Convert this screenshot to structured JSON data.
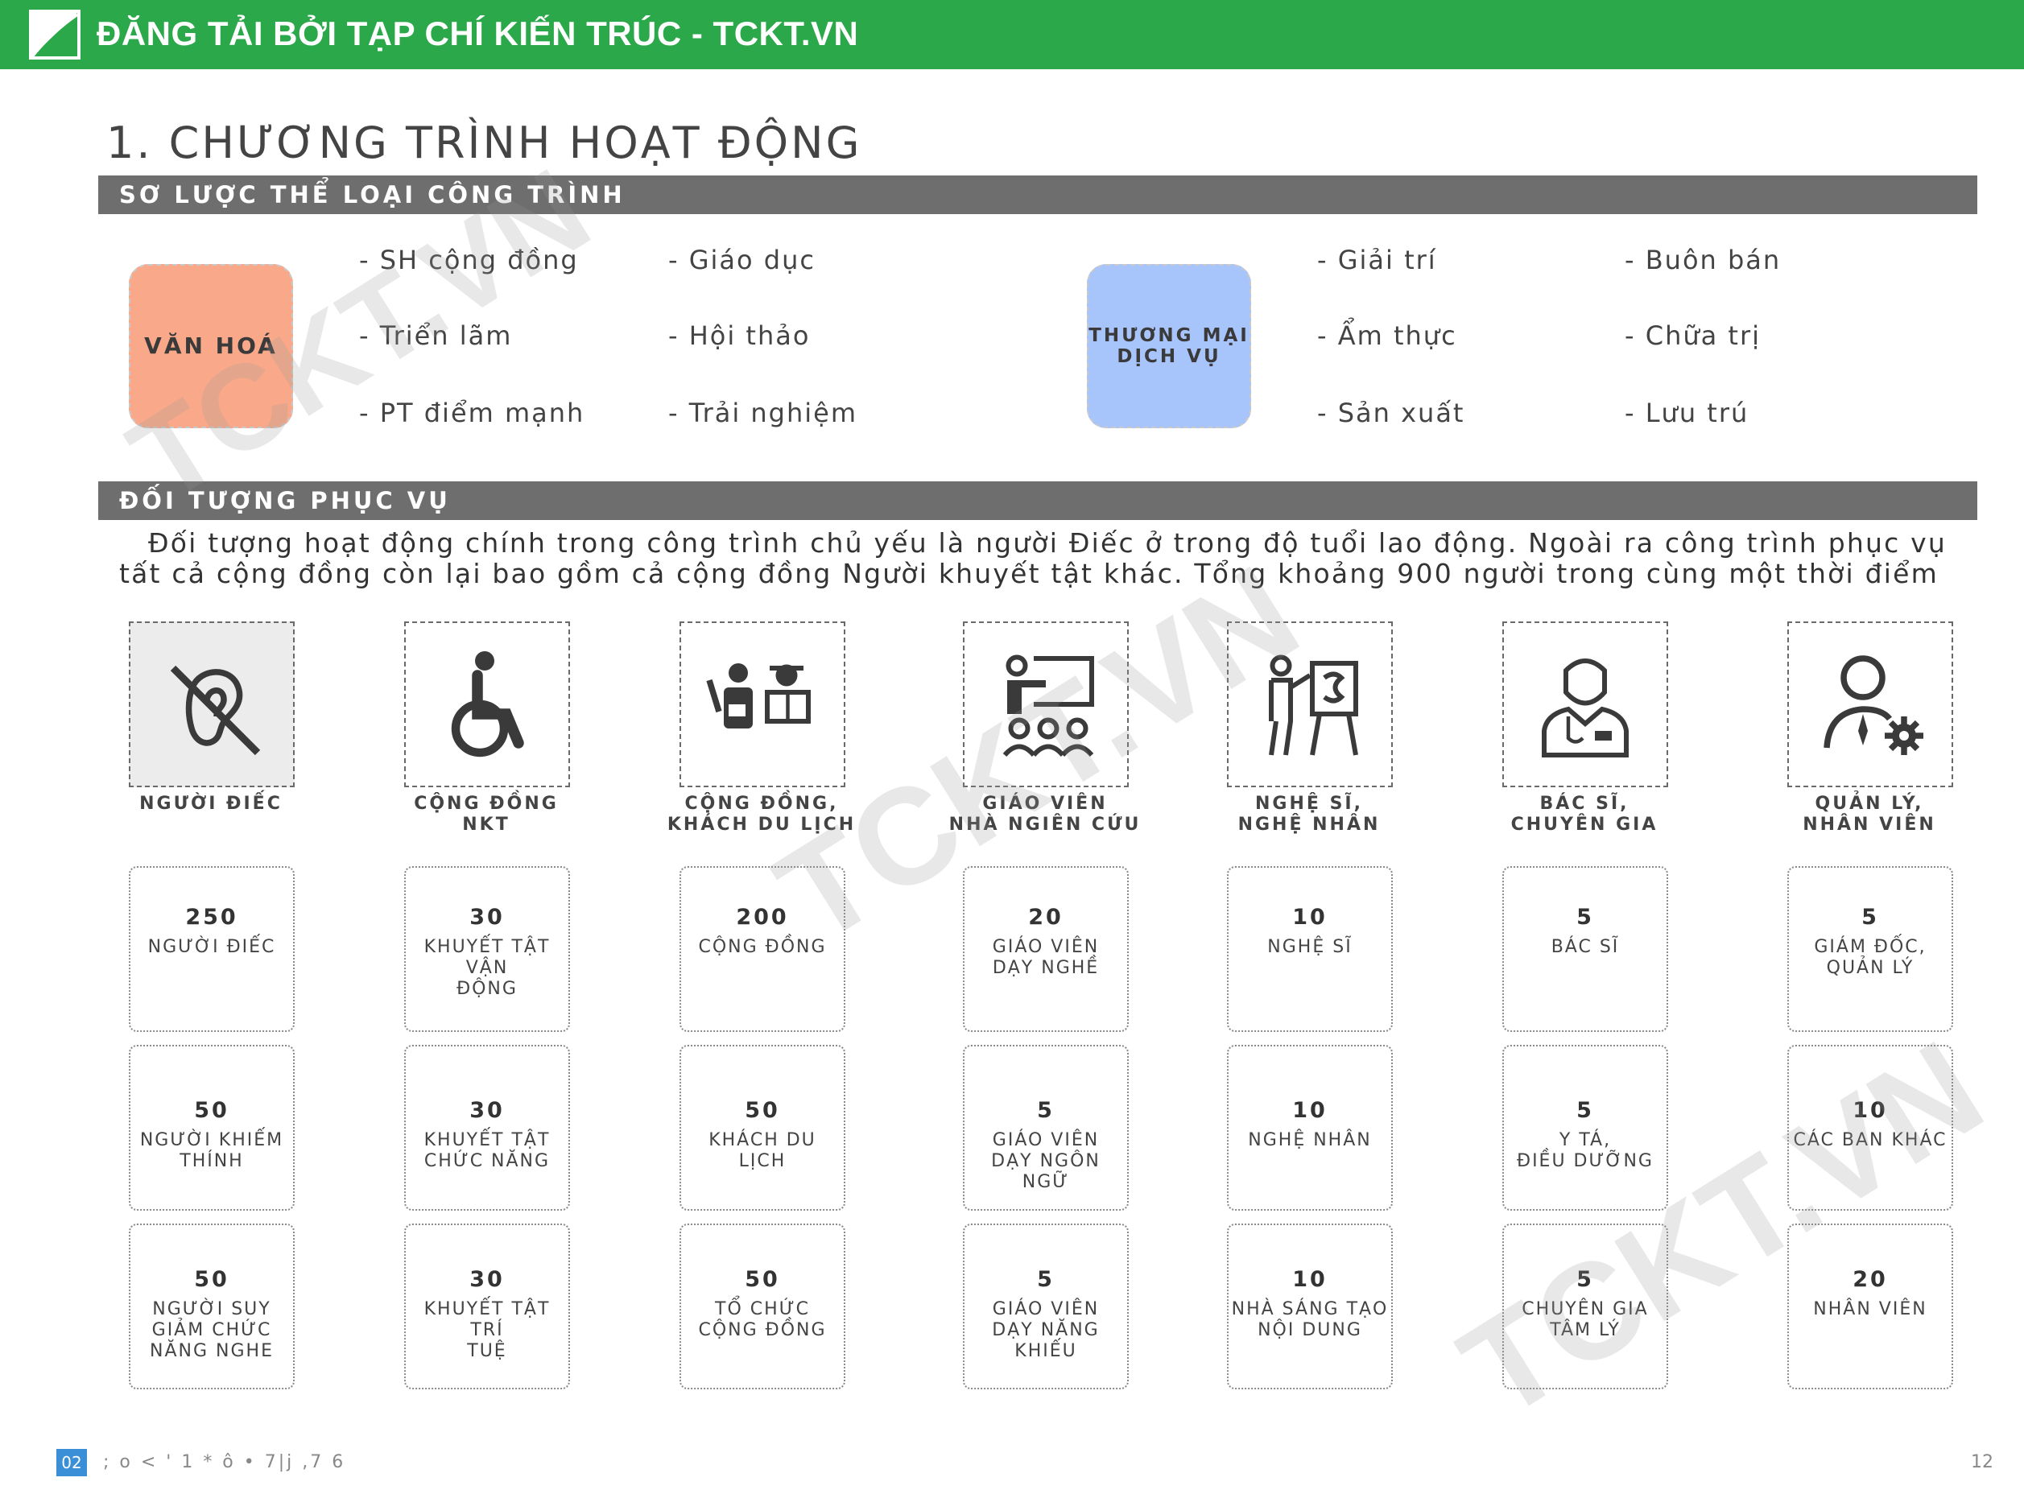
{
  "header": {
    "title": "ĐĂNG TẢI BỞI TẠP CHÍ KIẾN TRÚC - TCKT.VN"
  },
  "page_title": "1. CHƯƠNG TRÌNH HOẠT ĐỘNG",
  "sections": {
    "types": "SƠ LƯỢC THỂ LOẠI CÔNG TRÌNH",
    "audience": "ĐỐI TƯỢNG PHỤC VỤ"
  },
  "categories": {
    "van_hoa": {
      "label": "VĂN HOÁ",
      "color": "#f9a98a",
      "col1": [
        "- SH cộng đồng",
        "- Triển lãm",
        "- PT điểm mạnh"
      ],
      "col2": [
        "- Giáo dục",
        "- Hội thảo",
        "- Trải nghiệm"
      ]
    },
    "thuong_mai": {
      "label_line1": "THƯƠNG MẠI",
      "label_line2": "DỊCH VỤ",
      "color": "#a7c4fb",
      "col1": [
        "- Giải trí",
        "- Ẩm thực",
        "- Sản xuất"
      ],
      "col2": [
        "- Buôn bán",
        "- Chữa trị",
        "- Lưu trú"
      ]
    }
  },
  "description": "Đối tượng hoạt động chính trong công trình chủ yếu là người Điếc ở trong độ tuổi lao động. Ngoài ra công trình phục vụ tất cả cộng đồng còn lại bao gồm cả cộng đồng Người khuyết tật khác.  Tổng khoảng 900 người trong cùng một thời điểm",
  "groups": [
    {
      "label1": "NGƯỜI ĐIẾC",
      "label2": "",
      "icon": "deaf-ear-icon",
      "stats": [
        {
          "num": "250",
          "l1": "NGƯỜI ĐIẾC",
          "l2": "",
          "l3": ""
        },
        {
          "num": "50",
          "l1": "NGƯỜI KHIẾM",
          "l2": "THÍNH",
          "l3": ""
        },
        {
          "num": "50",
          "l1": "NGƯỜI SUY",
          "l2": "GIẢM CHỨC",
          "l3": "NĂNG NGHE"
        }
      ]
    },
    {
      "label1": "CỘNG ĐỒNG",
      "label2": "NKT",
      "icon": "wheelchair-icon",
      "stats": [
        {
          "num": "30",
          "l1": "KHUYẾT TẬT VẬN",
          "l2": "ĐỘNG",
          "l3": ""
        },
        {
          "num": "30",
          "l1": "KHUYẾT TẬT",
          "l2": "CHỨC NĂNG",
          "l3": ""
        },
        {
          "num": "30",
          "l1": "KHUYẾT TẬT TRÍ",
          "l2": "TUỆ",
          "l3": ""
        }
      ]
    },
    {
      "label1": "CỘNG ĐỒNG,",
      "label2": "KHÁCH DU LỊCH",
      "icon": "tourists-icon",
      "stats": [
        {
          "num": "200",
          "l1": "CỘNG ĐỒNG",
          "l2": "",
          "l3": ""
        },
        {
          "num": "50",
          "l1": "KHÁCH DU LỊCH",
          "l2": "",
          "l3": ""
        },
        {
          "num": "50",
          "l1": "TỔ CHỨC",
          "l2": "CỘNG ĐỒNG",
          "l3": ""
        }
      ]
    },
    {
      "label1": "GIÁO VIÊN",
      "label2": "NHÀ NGIÊN CỨU",
      "icon": "teacher-icon",
      "stats": [
        {
          "num": "20",
          "l1": "GIÁO VIÊN",
          "l2": "DẠY NGHỀ",
          "l3": ""
        },
        {
          "num": "5",
          "l1": "GIÁO VIÊN",
          "l2": "DẠY NGÔN NGỮ",
          "l3": ""
        },
        {
          "num": "5",
          "l1": "GIÁO VIÊN",
          "l2": "DẠY NĂNG",
          "l3": "KHIẾU"
        }
      ]
    },
    {
      "label1": "NGHỆ SĨ,",
      "label2": "NGHỆ NHÂN",
      "icon": "artist-easel-icon",
      "stats": [
        {
          "num": "10",
          "l1": "NGHỆ SĨ",
          "l2": "",
          "l3": ""
        },
        {
          "num": "10",
          "l1": "NGHỆ NHÂN",
          "l2": "",
          "l3": ""
        },
        {
          "num": "10",
          "l1": "NHÀ SÁNG TẠO",
          "l2": "NỘI DUNG",
          "l3": ""
        }
      ]
    },
    {
      "label1": "BÁC SĨ,",
      "label2": "CHUYÊN GIA",
      "icon": "doctor-icon",
      "stats": [
        {
          "num": "5",
          "l1": "BÁC SĨ",
          "l2": "",
          "l3": ""
        },
        {
          "num": "5",
          "l1": "Y TÁ,",
          "l2": "ĐIỀU DƯỠNG",
          "l3": ""
        },
        {
          "num": "5",
          "l1": "CHUYÊN GIA",
          "l2": "TÂM LÝ",
          "l3": ""
        }
      ]
    },
    {
      "label1": "QUẢN LÝ,",
      "label2": "NHÂN VIÊN",
      "icon": "manager-gear-icon",
      "stats": [
        {
          "num": "5",
          "l1": "GIÁM ĐỐC,",
          "l2": "QUẢN LÝ",
          "l3": ""
        },
        {
          "num": "10",
          "l1": "CÁC BAN KHÁC",
          "l2": "",
          "l3": ""
        },
        {
          "num": "20",
          "l1": "NHÂN VIÊN",
          "l2": "",
          "l3": ""
        }
      ]
    }
  ],
  "watermark": "TCKT.VN",
  "footer": {
    "badge": "02",
    "text": "; o <  '   1 *   ô •   7|j ,7 6",
    "page": "12"
  }
}
